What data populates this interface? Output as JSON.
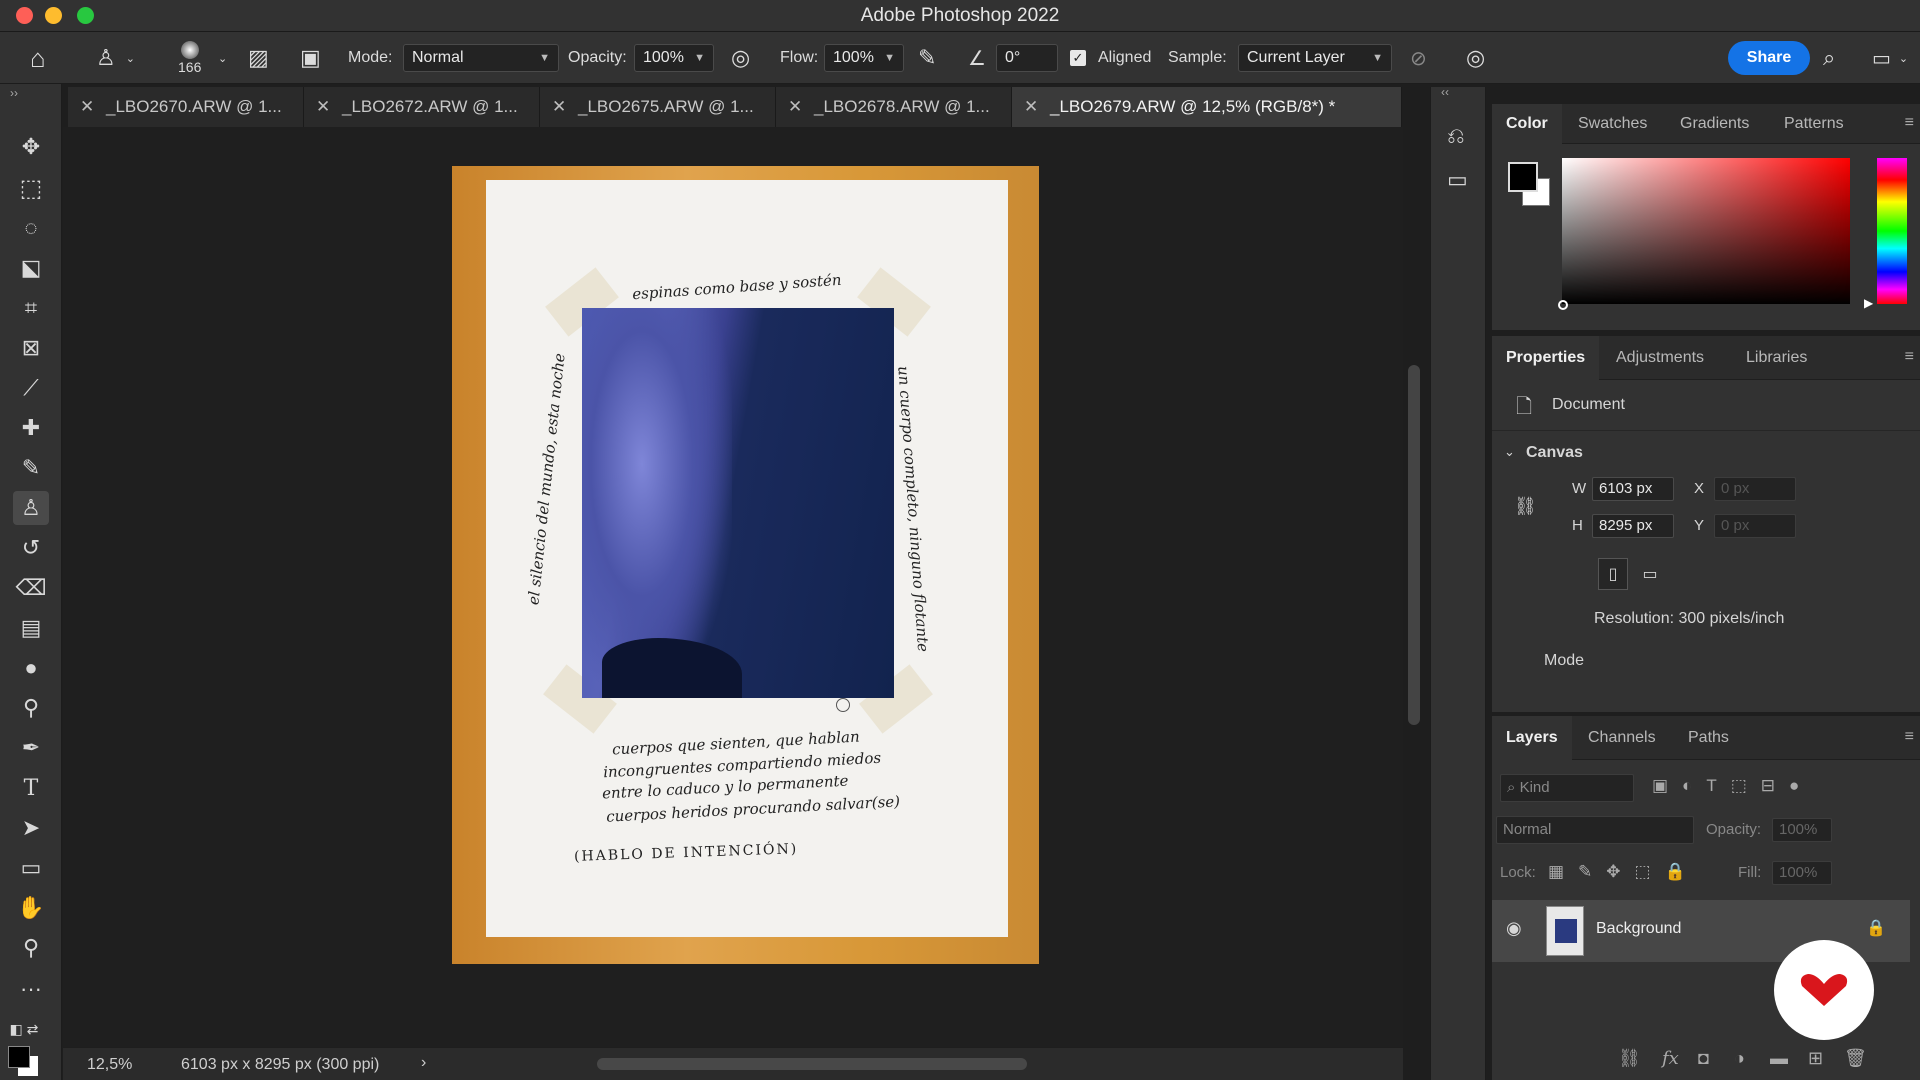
{
  "window": {
    "title": "Adobe Photoshop 2022"
  },
  "options_bar": {
    "brush_size": "166",
    "mode_label": "Mode:",
    "mode_value": "Normal",
    "opacity_label": "Opacity:",
    "opacity_value": "100%",
    "flow_label": "Flow:",
    "flow_value": "100%",
    "angle_value": "0°",
    "aligned_label": "Aligned",
    "sample_label": "Sample:",
    "sample_value": "Current Layer",
    "share_label": "Share"
  },
  "tabs": [
    {
      "label": "_LBO2670.ARW @ 1..."
    },
    {
      "label": "_LBO2672.ARW @ 1..."
    },
    {
      "label": "_LBO2675.ARW @ 1..."
    },
    {
      "label": "_LBO2678.ARW @ 1..."
    },
    {
      "label": "_LBO2679.ARW @ 12,5% (RGB/8*) *"
    }
  ],
  "artwork": {
    "top_text": "espinas como base y sostén",
    "left_text": "el silencio del mundo, esta noche",
    "right_text": "un cuerpo completo, ninguno ​​flotante",
    "bottom_lines": [
      "cuerpos que sienten, que hablan",
      "incongruentes compartiendo miedos",
      "entre lo caduco y lo permanente",
      "cuerpos heridos procurando salvar(se)"
    ],
    "signature": "(HABLO DE INTENCIÓN)"
  },
  "status": {
    "zoom": "12,5%",
    "doc_info": "6103 px x 8295 px (300 ppi)"
  },
  "color_panel": {
    "tabs": [
      "Color",
      "Swatches",
      "Gradients",
      "Patterns"
    ],
    "foreground": "#000000",
    "background": "#ffffff"
  },
  "properties_panel": {
    "tabs": [
      "Properties",
      "Adjustments",
      "Libraries"
    ],
    "doc_label": "Document",
    "canvas_label": "Canvas",
    "w_label": "W",
    "w_value": "6103 px",
    "h_label": "H",
    "h_value": "8295 px",
    "x_label": "X",
    "x_placeholder": "0 px",
    "y_label": "Y",
    "y_placeholder": "0 px",
    "resolution": "Resolution: 300 pixels/inch",
    "mode_label": "Mode"
  },
  "layers_panel": {
    "tabs": [
      "Layers",
      "Channels",
      "Paths"
    ],
    "kind_placeholder": "Kind",
    "blend_mode": "Normal",
    "opacity_label": "Opacity:",
    "opacity_value": "100%",
    "lock_label": "Lock:",
    "fill_label": "Fill:",
    "fill_value": "100%",
    "layer_name": "Background"
  }
}
